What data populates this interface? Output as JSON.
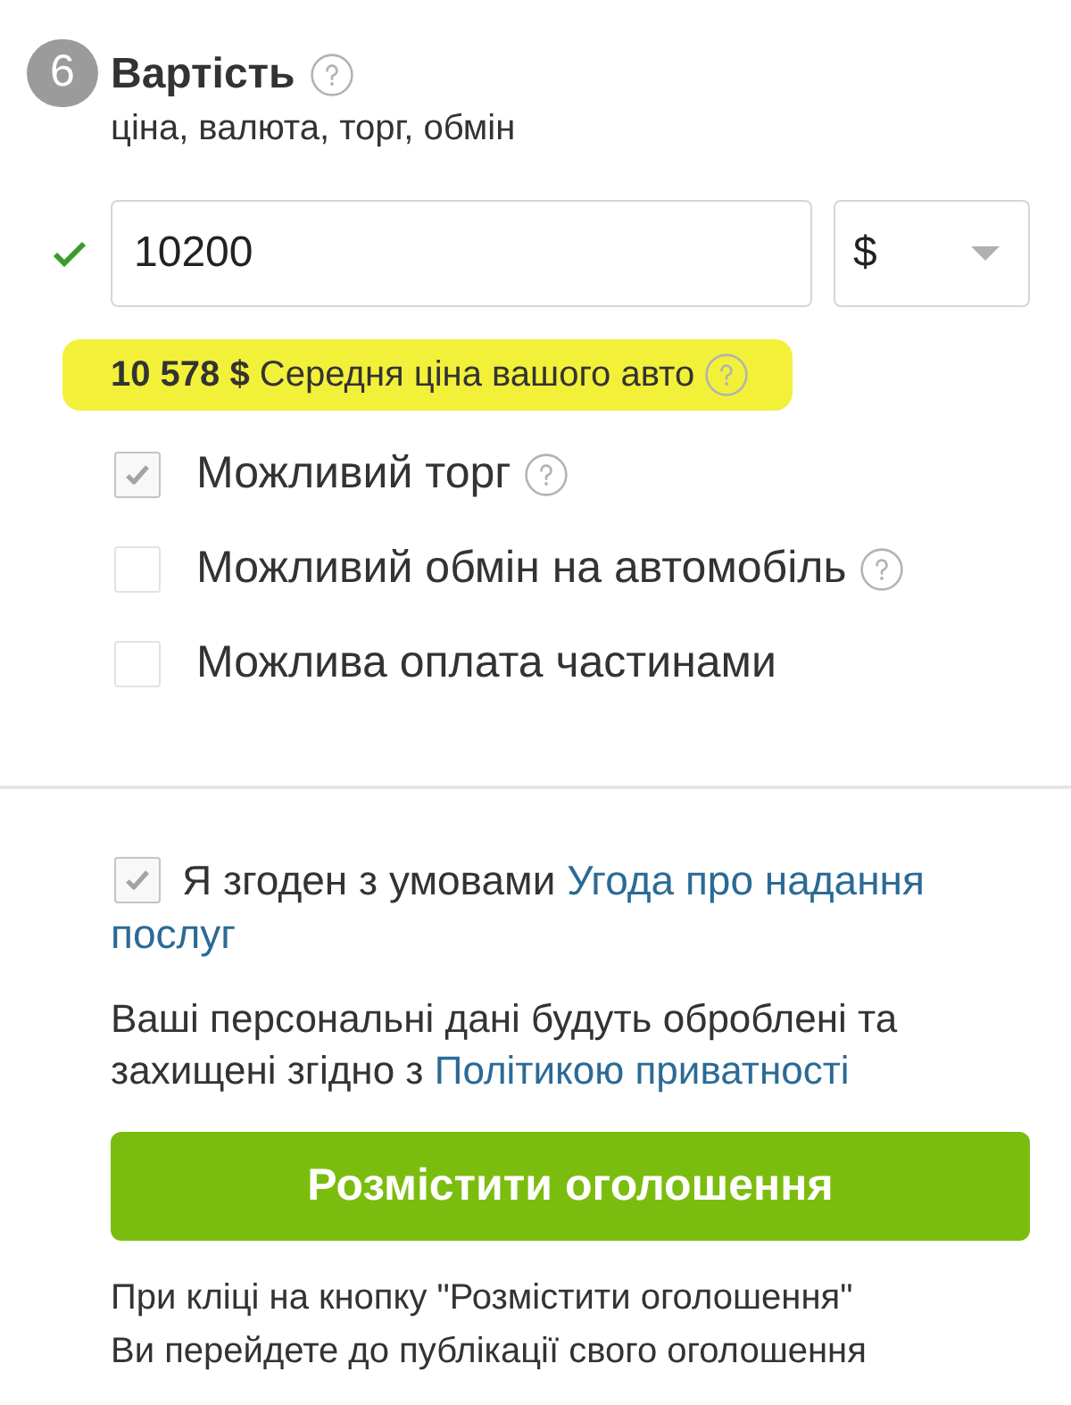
{
  "section": {
    "step": "6",
    "title": "Вартість",
    "help": true,
    "subtitle": "ціна, валюта, торг, обмін"
  },
  "price": {
    "valid": true,
    "value": "10200",
    "currency": "$"
  },
  "average_price": {
    "highlighted": true,
    "text": "**10 578 $** Середня ціна вашого авто",
    "help": true
  },
  "options": [
    {
      "label": "Можливий торг",
      "checked": true,
      "help": true
    },
    {
      "label": "Можливий обмін на автомобіль",
      "checked": false,
      "help": true
    },
    {
      "label": "Можлива оплата частинами",
      "checked": false,
      "help": false
    }
  ],
  "agreement": {
    "checked": true,
    "text": "Я згоден з умовами",
    "link_lines": [
      "Угода про надання",
      "послуг"
    ]
  },
  "privacy": {
    "text": "Ваші персональні дані будуть оброблені та захищені згідно з",
    "link": "Політикою приватності"
  },
  "submit_button": "Розмістити оголошення",
  "note": "При кліці на кнопку \"Розмістити оголошення\"\nВи перейдете до публікації свого оголошення"
}
